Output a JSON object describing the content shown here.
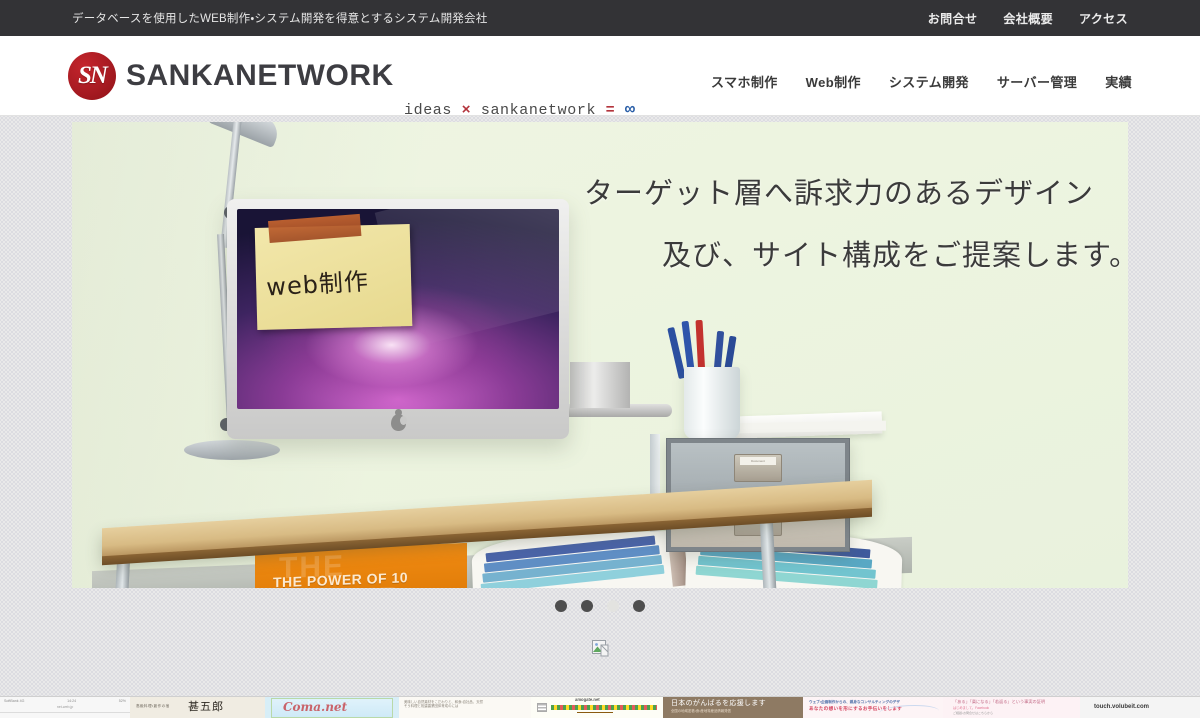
{
  "topbar": {
    "tagline": "データベースを使用したWEB制作・システム開発を得意とするシステム開発会社",
    "links": [
      {
        "label": "お問合せ"
      },
      {
        "label": "会社概要"
      },
      {
        "label": "アクセス"
      }
    ]
  },
  "header": {
    "logo_monogram": "SN",
    "logo_text": "SANKANETWORK",
    "equation": {
      "term1": "ideas",
      "op_times": "×",
      "term2": "sankanetwork",
      "op_equals": "=",
      "result": "∞"
    },
    "nav": [
      {
        "label": "スマホ制作"
      },
      {
        "label": "Web制作"
      },
      {
        "label": "システム開発"
      },
      {
        "label": "サーバー管理"
      },
      {
        "label": "実績"
      }
    ]
  },
  "hero": {
    "headline_line1": "ターゲット層へ訴求力のあるデザイン",
    "headline_line2": "及び、サイト構成をご提案します。",
    "sticky_note_text": "web制作",
    "book_title": "THE POWER OF 10",
    "book_ghost": "THE POWER",
    "drawer_label_top": "Document",
    "drawer_label_bottom": "Materials",
    "slide_background": "#edf4e0",
    "dots": [
      {
        "state": "active"
      },
      {
        "state": "active"
      },
      {
        "state": "inactive"
      },
      {
        "state": "active"
      }
    ]
  },
  "content": {
    "broken_image_alt": ""
  },
  "thumbstrip": {
    "items": [
      {
        "name": "mobile-screenshot",
        "carrier": "SoftBank 4G",
        "time": "14:24",
        "battery": "52%",
        "url": "net-web.jp"
      },
      {
        "name": "jingoro-site",
        "title": "甚五郎",
        "subtitle": "高級料理・創作の宿"
      },
      {
        "name": "coma-net-site",
        "title": "Coma.net"
      },
      {
        "name": "text-article-site",
        "line1": "美味しい自然素材をこだわりと、和食・自社品、天然",
        "line2": "そう料理と相違農業団体育成のには"
      },
      {
        "name": "amogate-site",
        "title": "amogate.net"
      },
      {
        "name": "ganbare-nippon-site",
        "title": "日本のがんばるを応援します",
        "subtitle": "全国の地域密着・食・産地特産品情報発信"
      },
      {
        "name": "blue-corporate-site",
        "line1": "ウェブ・企画制作からの、親身なコンサルティングのデザ",
        "line2": "あなたの想いを形にするお手伝いをします"
      },
      {
        "name": "wakagaeru-site",
        "title": "「ある」「楽になる」「若返る」という事実の証明",
        "subtitle": "はじめまして。Facebook",
        "subtitle2": "ご相談・お問合せはこちらから"
      },
      {
        "name": "volubeit-site",
        "url": "touch.volubeit.com"
      }
    ]
  }
}
